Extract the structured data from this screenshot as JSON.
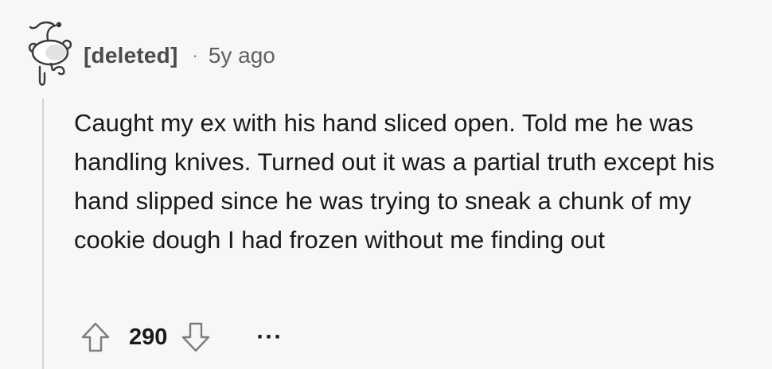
{
  "comment": {
    "author": "[deleted]",
    "separator": "·",
    "time_ago": "5y ago",
    "avatar_icon": "deleted-user-snoo-icon",
    "body": "Caught my ex with his hand sliced open. Told me he was handling knives. Turned out it was a partial truth except his hand slipped since he was trying to sneak a chunk of my cookie dough I had frozen without me finding out",
    "score": "290",
    "upvote_icon": "arrow-up-outline-icon",
    "downvote_icon": "arrow-down-outline-icon",
    "more_label": "···"
  },
  "colors": {
    "background": "#f6f7f8",
    "text": "#1a1a1b",
    "meta_text": "#5f6163",
    "thread_line": "#d2d4d6"
  }
}
